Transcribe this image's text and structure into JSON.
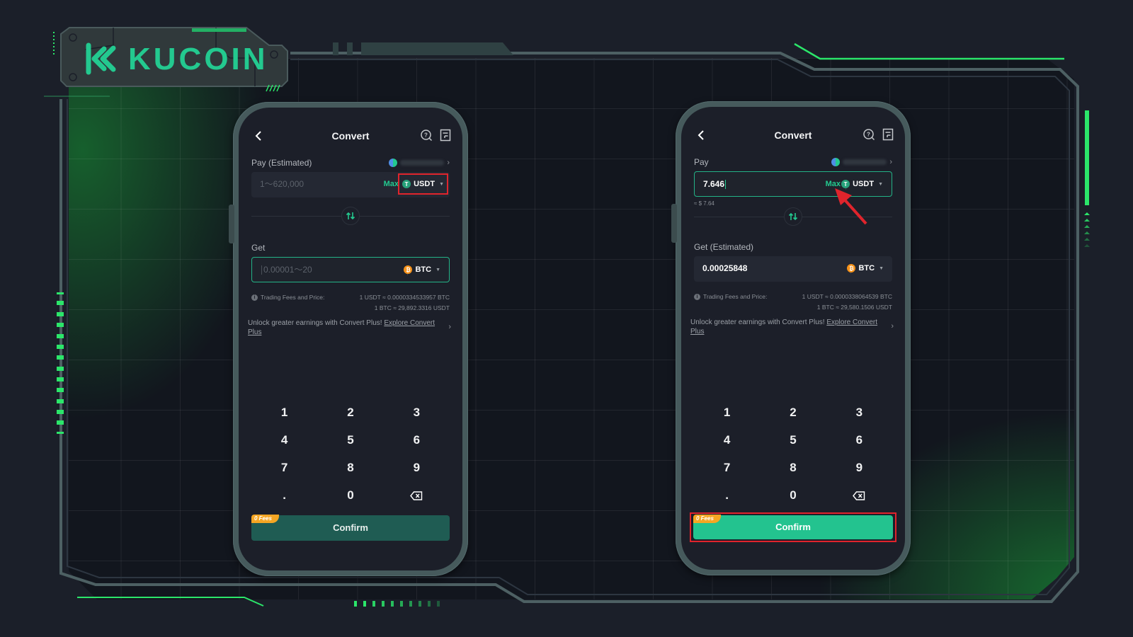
{
  "brand": {
    "name": "KUCOIN",
    "accent": "#23c98f",
    "neon": "#2be66a",
    "highlight": "#e0242c"
  },
  "phones": [
    {
      "id": "before",
      "nav": {
        "title": "Convert",
        "back_icon": "chevron-left-icon",
        "help_icon": "help-search-icon",
        "orders_icon": "order-history-icon"
      },
      "pay": {
        "label": "Pay (Estimated)",
        "balance": "Balance: 7.646",
        "input_placeholder": "1～620,000",
        "input_value": "",
        "max_label": "Max",
        "coin": "USDT",
        "coin_highlighted": true
      },
      "swap_icon": "swap-arrows-icon",
      "get": {
        "label": "Get",
        "input_placeholder": "0.00001～20",
        "input_value": "",
        "coin": "BTC"
      },
      "fees": {
        "label": "Trading Fees and Price:",
        "rate_1": "1 USDT ≈ 0.0000334533957 BTC",
        "rate_2": "1 BTC ≈ 29,892.3316 USDT"
      },
      "promo": {
        "text": "Unlock greater earnings with Convert Plus! ",
        "link": "Explore Convert Plus"
      },
      "keypad": [
        "1",
        "2",
        "3",
        "4",
        "5",
        "6",
        "7",
        "8",
        "9",
        ".",
        "0",
        "⌫"
      ],
      "confirm": {
        "label": "Confirm",
        "badge": "0 Fees",
        "enabled": false,
        "highlighted": false
      }
    },
    {
      "id": "after",
      "nav": {
        "title": "Convert",
        "back_icon": "chevron-left-icon",
        "help_icon": "help-search-icon",
        "orders_icon": "order-history-icon"
      },
      "pay": {
        "label": "Pay",
        "balance": "Balance: 7.646",
        "input_placeholder": "",
        "input_value": "7.646",
        "usd_approx": "≈ $ 7.64",
        "max_label": "Max",
        "coin": "USDT",
        "coin_highlighted": false,
        "annotation": "red arrow pointing to Max"
      },
      "swap_icon": "swap-arrows-icon",
      "get": {
        "label": "Get (Estimated)",
        "input_placeholder": "",
        "input_value": "0.00025848",
        "coin": "BTC"
      },
      "fees": {
        "label": "Trading Fees and Price:",
        "rate_1": "1 USDT ≈ 0.0000338064539 BTC",
        "rate_2": "1 BTC ≈ 29,580.1506 USDT"
      },
      "promo": {
        "text": "Unlock greater earnings with Convert Plus! ",
        "link": "Explore Convert Plus"
      },
      "keypad": [
        "1",
        "2",
        "3",
        "4",
        "5",
        "6",
        "7",
        "8",
        "9",
        ".",
        "0",
        "⌫"
      ],
      "confirm": {
        "label": "Confirm",
        "badge": "0 Fees",
        "enabled": true,
        "highlighted": true
      }
    }
  ]
}
